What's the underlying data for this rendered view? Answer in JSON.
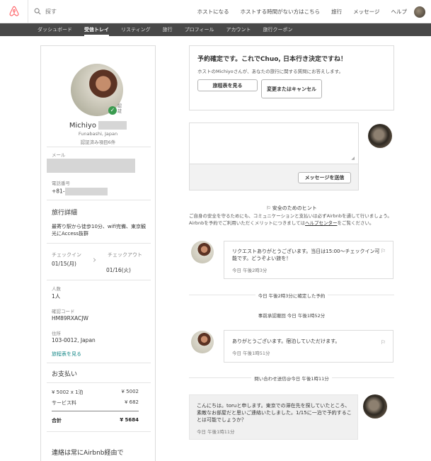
{
  "topbar": {
    "search_placeholder": "探す",
    "nav": [
      "ホストになる",
      "ホストする時間がない方はこちら",
      "旅行",
      "メッセージ",
      "ヘルプ"
    ]
  },
  "subnav": {
    "items": [
      "ダッシュボード",
      "受信トレイ",
      "リスティング",
      "旅行",
      "プロフィール",
      "アカウント",
      "旅行クーポン"
    ],
    "active_index": 1
  },
  "host": {
    "name": "Michiyo",
    "verified_label": "認証",
    "location": "Funabashi, Japan",
    "verification_count": "認証済み項目6件"
  },
  "contact": {
    "email_label": "メール",
    "phone_label": "電話番号",
    "phone_prefix": "+81-"
  },
  "trip": {
    "section_title": "旅行詳細",
    "description": "最寄り駅から徒歩10分、wifi完備、東京観光にAccess抜群",
    "checkin_label": "チェックイン",
    "checkin_date": "01/15(月)",
    "checkout_label": "チェックアウト",
    "checkout_date": "01/16(火)",
    "guests_label": "人数",
    "guests_value": "1人",
    "code_label": "確認コード",
    "code_value": "HM89RXACJW",
    "address_label": "住所",
    "address_value": "103-0012, Japan",
    "itinerary_link": "旅程表を見る"
  },
  "payment": {
    "section_title": "お支払い",
    "rows": [
      {
        "label": "¥ 5002 x 1泊",
        "amount": "¥ 5002"
      },
      {
        "label": "サービス料",
        "amount": "¥ 682"
      }
    ],
    "total_label": "合計",
    "total_amount": "¥ 5684"
  },
  "contact_note": "連絡は常にAirbnb経由で",
  "confirm": {
    "title": "予約確定です。これでChuo, 日本行き決定ですね！",
    "subtitle": "ホストのMichiyoさんが、あなたの旅行に関する質問にお答えします。",
    "itinerary_button": "旅程表を見る",
    "change_button": "変更またはキャンセル"
  },
  "compose": {
    "send_button": "メッセージを送信"
  },
  "safety": {
    "title": "安全のためのヒント",
    "body_before": "ご自身の安全を守るためにも、コミュニケーションと支払いは必ずAirbnbを通して行いましょう。Airbnbを予約でご利用いただくメリットにつきましては",
    "link": "ヘルプセンター",
    "body_after": "をご覧ください。"
  },
  "messages": [
    {
      "text": "リクエストありがとうございます。当日は15:00〜チェックイン可能です。どうぞよい旅を！",
      "time": "今日 午後2時3分"
    },
    {
      "text": "ありがとうございます。宿泊していただけます。",
      "time": "今日 午後1時51分"
    },
    {
      "text": "こんにちは。toruと申します。東京での滞在先を探していたところ、素敵なお部屋だと思いご連絡いたしました。1/15に一泊で予約することは可能でしょうか？",
      "time": "今日 午後1時11分"
    }
  ],
  "dividers": {
    "confirmed": "今日 午後2時3分に確定した予約",
    "preapproved": "事前承認撤回 今日 午後1時52分",
    "inquiry": "問い合わせ送信@今日 午後1時11分"
  }
}
